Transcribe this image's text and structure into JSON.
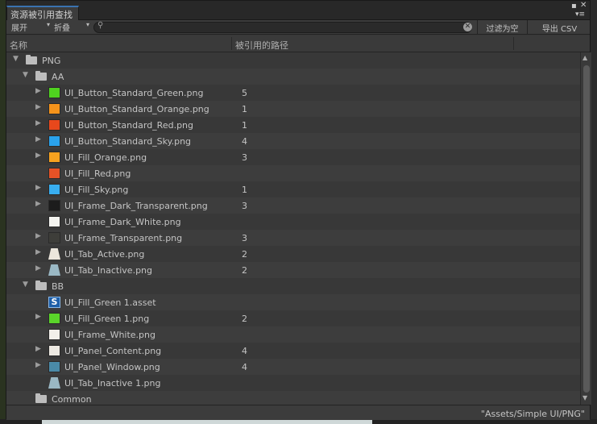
{
  "window": {
    "tab_title": "资源被引用查找",
    "menu_glyph": "▾≡",
    "max_glyph": "▪",
    "close_glyph": "✕"
  },
  "toolbar": {
    "expand_label": "展开",
    "collapse_label": "折叠",
    "search_placeholder": "",
    "filter_empty_label": "过滤为空",
    "export_csv_label": "导出 CSV"
  },
  "columns": {
    "name": "名称",
    "referenced_path": "被引用的路径"
  },
  "tree": [
    {
      "depth": 0,
      "kind": "folder",
      "label": "PNG",
      "fold": "open",
      "count": ""
    },
    {
      "depth": 1,
      "kind": "folder",
      "label": "AA",
      "fold": "open",
      "count": ""
    },
    {
      "depth": 2,
      "kind": "file",
      "label": "UI_Button_Standard_Green.png",
      "thumb": "#4fd21f",
      "fold": "closed",
      "count": "5"
    },
    {
      "depth": 2,
      "kind": "file",
      "label": "UI_Button_Standard_Orange.png",
      "thumb": "#f5931b",
      "fold": "closed",
      "count": "1"
    },
    {
      "depth": 2,
      "kind": "file",
      "label": "UI_Button_Standard_Red.png",
      "thumb": "#e8481c",
      "fold": "closed",
      "count": "1"
    },
    {
      "depth": 2,
      "kind": "file",
      "label": "UI_Button_Standard_Sky.png",
      "thumb": "#2aa2ec",
      "fold": "closed",
      "count": "4"
    },
    {
      "depth": 2,
      "kind": "file",
      "label": "UI_Fill_Orange.png",
      "thumb": "#f7a21f",
      "fold": "closed",
      "count": "3"
    },
    {
      "depth": 2,
      "kind": "file",
      "label": "UI_Fill_Red.png",
      "thumb": "#e65226",
      "fold": "none",
      "count": ""
    },
    {
      "depth": 2,
      "kind": "file",
      "label": "UI_Fill_Sky.png",
      "thumb": "#38aef0",
      "fold": "closed",
      "count": "1"
    },
    {
      "depth": 2,
      "kind": "file",
      "label": "UI_Frame_Dark_Transparent.png",
      "thumb": "#1c1c1c",
      "fold": "closed",
      "count": "3"
    },
    {
      "depth": 2,
      "kind": "file",
      "label": "UI_Frame_Dark_White.png",
      "thumb": "#f4f4f0",
      "fold": "none",
      "count": ""
    },
    {
      "depth": 2,
      "kind": "file",
      "label": "UI_Frame_Transparent.png",
      "thumb": "#3e3e3a",
      "fold": "closed",
      "count": "3"
    },
    {
      "depth": 2,
      "kind": "file",
      "label": "UI_Tab_Active.png",
      "thumb": "#ece6dc",
      "shape": "tab",
      "fold": "closed",
      "count": "2"
    },
    {
      "depth": 2,
      "kind": "file",
      "label": "UI_Tab_Inactive.png",
      "thumb": "#9ab8c4",
      "shape": "tab",
      "fold": "closed",
      "count": "2"
    },
    {
      "depth": 1,
      "kind": "folder",
      "label": "BB",
      "fold": "open",
      "count": ""
    },
    {
      "depth": 2,
      "kind": "file",
      "label": "UI_Fill_Green 1.asset",
      "thumb": "script",
      "fold": "none",
      "count": ""
    },
    {
      "depth": 2,
      "kind": "file",
      "label": "UI_Fill_Green 1.png",
      "thumb": "#5ad42a",
      "fold": "closed",
      "count": "2"
    },
    {
      "depth": 2,
      "kind": "file",
      "label": "UI_Frame_White.png",
      "thumb": "#f2efea",
      "fold": "none",
      "count": ""
    },
    {
      "depth": 2,
      "kind": "file",
      "label": "UI_Panel_Content.png",
      "thumb": "#ede9e2",
      "fold": "closed",
      "count": "4"
    },
    {
      "depth": 2,
      "kind": "file",
      "label": "UI_Panel_Window.png",
      "thumb": "#4a8aa8",
      "fold": "closed",
      "count": "4"
    },
    {
      "depth": 2,
      "kind": "file",
      "label": "UI_Tab_Inactive 1.png",
      "thumb": "#9ab8c4",
      "shape": "tab",
      "fold": "none",
      "count": ""
    },
    {
      "depth": 1,
      "kind": "folder",
      "label": "Common",
      "fold": "none",
      "count": ""
    }
  ],
  "status": {
    "selected_path": "\"Assets/Simple UI/PNG\""
  }
}
